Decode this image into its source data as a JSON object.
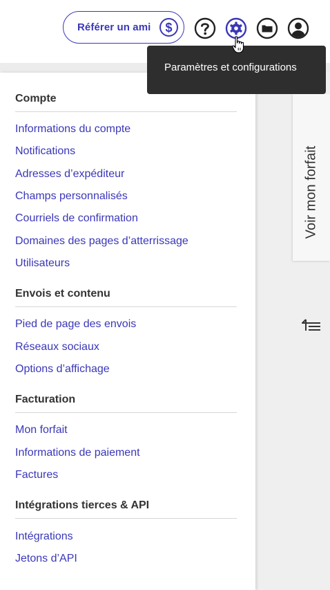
{
  "header": {
    "refer_label": "Référer un ami",
    "refer_icon_glyph": "$",
    "icons": [
      "help-icon",
      "gear-icon",
      "folder-icon",
      "user-icon"
    ]
  },
  "tooltip": {
    "text": "Paramètres et configurations"
  },
  "side_tab": {
    "label": "Voir mon forfait"
  },
  "menu": {
    "sections": [
      {
        "title": "Compte",
        "items": [
          "Informations du compte",
          "Notifications",
          "Adresses d’expéditeur",
          "Champs personnalisés",
          "Courriels de confirmation",
          "Domaines des pages d’atterrissage",
          "Utilisateurs"
        ]
      },
      {
        "title": "Envois et contenu",
        "items": [
          "Pied de page des envois",
          "Réseaux sociaux",
          "Options d’affichage"
        ]
      },
      {
        "title": "Facturation",
        "items": [
          "Mon forfait",
          "Informations de paiement",
          "Factures"
        ]
      },
      {
        "title": "Intégrations tierces & API",
        "items": [
          "Intégrations",
          "Jetons d’API"
        ]
      }
    ]
  },
  "colors": {
    "accent": "#3a37b8",
    "tooltip_bg": "#2e2e2e",
    "text": "#333333"
  }
}
